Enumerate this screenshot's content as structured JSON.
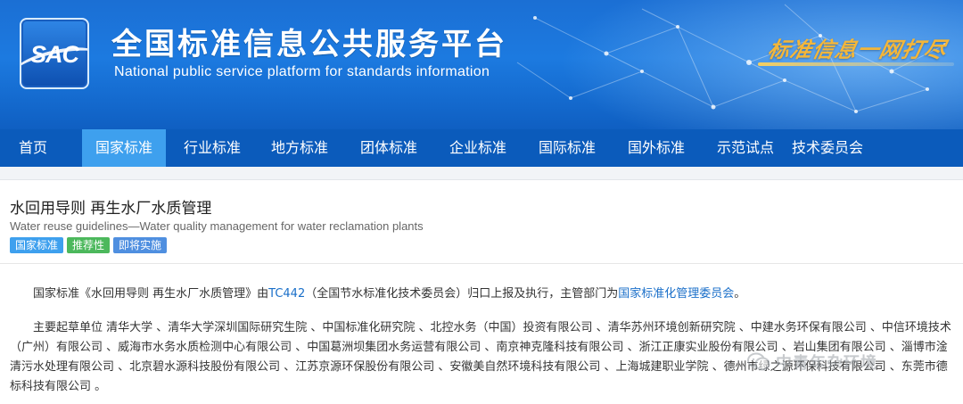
{
  "header": {
    "logo_text": "SAC",
    "site_title": "全国标准信息公共服务平台",
    "site_subtitle": "National public service platform  for standards information",
    "slogan": "标准信息一网打尽"
  },
  "nav": {
    "items": [
      {
        "label": "首页"
      },
      {
        "label": "国家标准"
      },
      {
        "label": "行业标准"
      },
      {
        "label": "地方标准"
      },
      {
        "label": "团体标准"
      },
      {
        "label": "企业标准"
      },
      {
        "label": "国际标准"
      },
      {
        "label": "国外标准"
      },
      {
        "label": "示范试点"
      },
      {
        "label": "技术委员会"
      }
    ],
    "active": "国家标准"
  },
  "standard": {
    "title": "水回用导则 再生水厂水质管理",
    "title_en": "Water reuse guidelines—Water quality management for water reclamation plants",
    "tags": [
      {
        "label": "国家标准",
        "color": "#3ea0ee"
      },
      {
        "label": "推荐性",
        "color": "#4cb85c"
      },
      {
        "label": "即将实施",
        "color": "#4f8fe0"
      }
    ]
  },
  "body": {
    "p1_prefix": "国家标准《水回用导则 再生水厂水质管理》由",
    "p1_link1": "TC442",
    "p1_mid": "（全国节水标准化技术委员会）归口上报及执行，主管部门为",
    "p1_link2": "国家标准化管理委员会",
    "p1_suffix": "。",
    "p2": "主要起草单位 清华大学 、清华大学深圳国际研究生院 、中国标准化研究院 、北控水务（中国）投资有限公司 、清华苏州环境创新研究院 、中建水务环保有限公司 、中信环境技术（广州）有限公司 、威海市水务水质检测中心有限公司 、中国葛洲坝集团水务运营有限公司 、南京神克隆科技有限公司 、浙江正康实业股份有限公司 、岩山集团有限公司 、淄博市淦清污水处理有限公司 、北京碧水源科技股份有限公司 、江苏京源环保股份有限公司 、安徽美自然环境科技有限公司 、上海城建职业学院 、德州市绿之源环保科技有限公司 、东莞市德标科技有限公司 。"
  },
  "watermark": {
    "text": "中青年杂环境"
  }
}
